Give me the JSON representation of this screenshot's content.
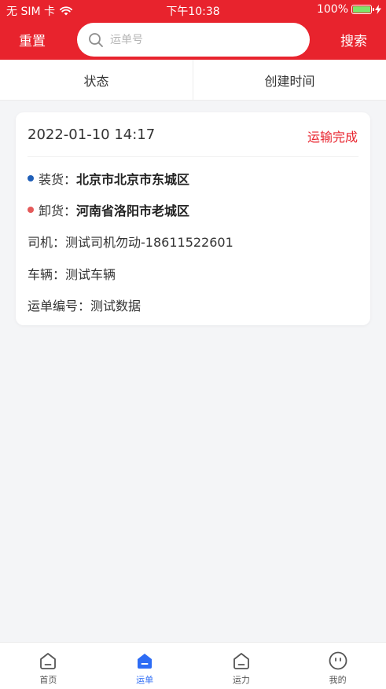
{
  "status_bar": {
    "carrier": "无 SIM 卡",
    "time": "下午10:38",
    "battery": "100%",
    "battery_color": "#7ee36a"
  },
  "nav": {
    "reset_label": "重置",
    "search_placeholder": "运单号",
    "search_label": "搜索"
  },
  "filters": [
    {
      "label": "状态"
    },
    {
      "label": "创建时间"
    }
  ],
  "order": {
    "date": "2022-01-10 14:17",
    "status": "运输完成",
    "load_label": "装货：",
    "load_value": "北京市北京市东城区",
    "unload_label": "卸货：",
    "unload_value": "河南省洛阳市老城区",
    "driver_label": "司机：",
    "driver_value": "测试司机勿动-18611522601",
    "vehicle_label": "车辆：",
    "vehicle_value": "测试车辆",
    "waybill_label": "运单编号：",
    "waybill_value": "测试数据"
  },
  "colors": {
    "brand_red": "#e8232d",
    "load_dot": "#1f5fb8",
    "unload_dot": "#e45a5a",
    "active_tab": "#2d6cf5"
  },
  "tabs": [
    {
      "label": "首页",
      "icon": "home-icon"
    },
    {
      "label": "运单",
      "icon": "waybill-icon",
      "active": true
    },
    {
      "label": "运力",
      "icon": "capacity-icon"
    },
    {
      "label": "我的",
      "icon": "profile-icon"
    }
  ]
}
